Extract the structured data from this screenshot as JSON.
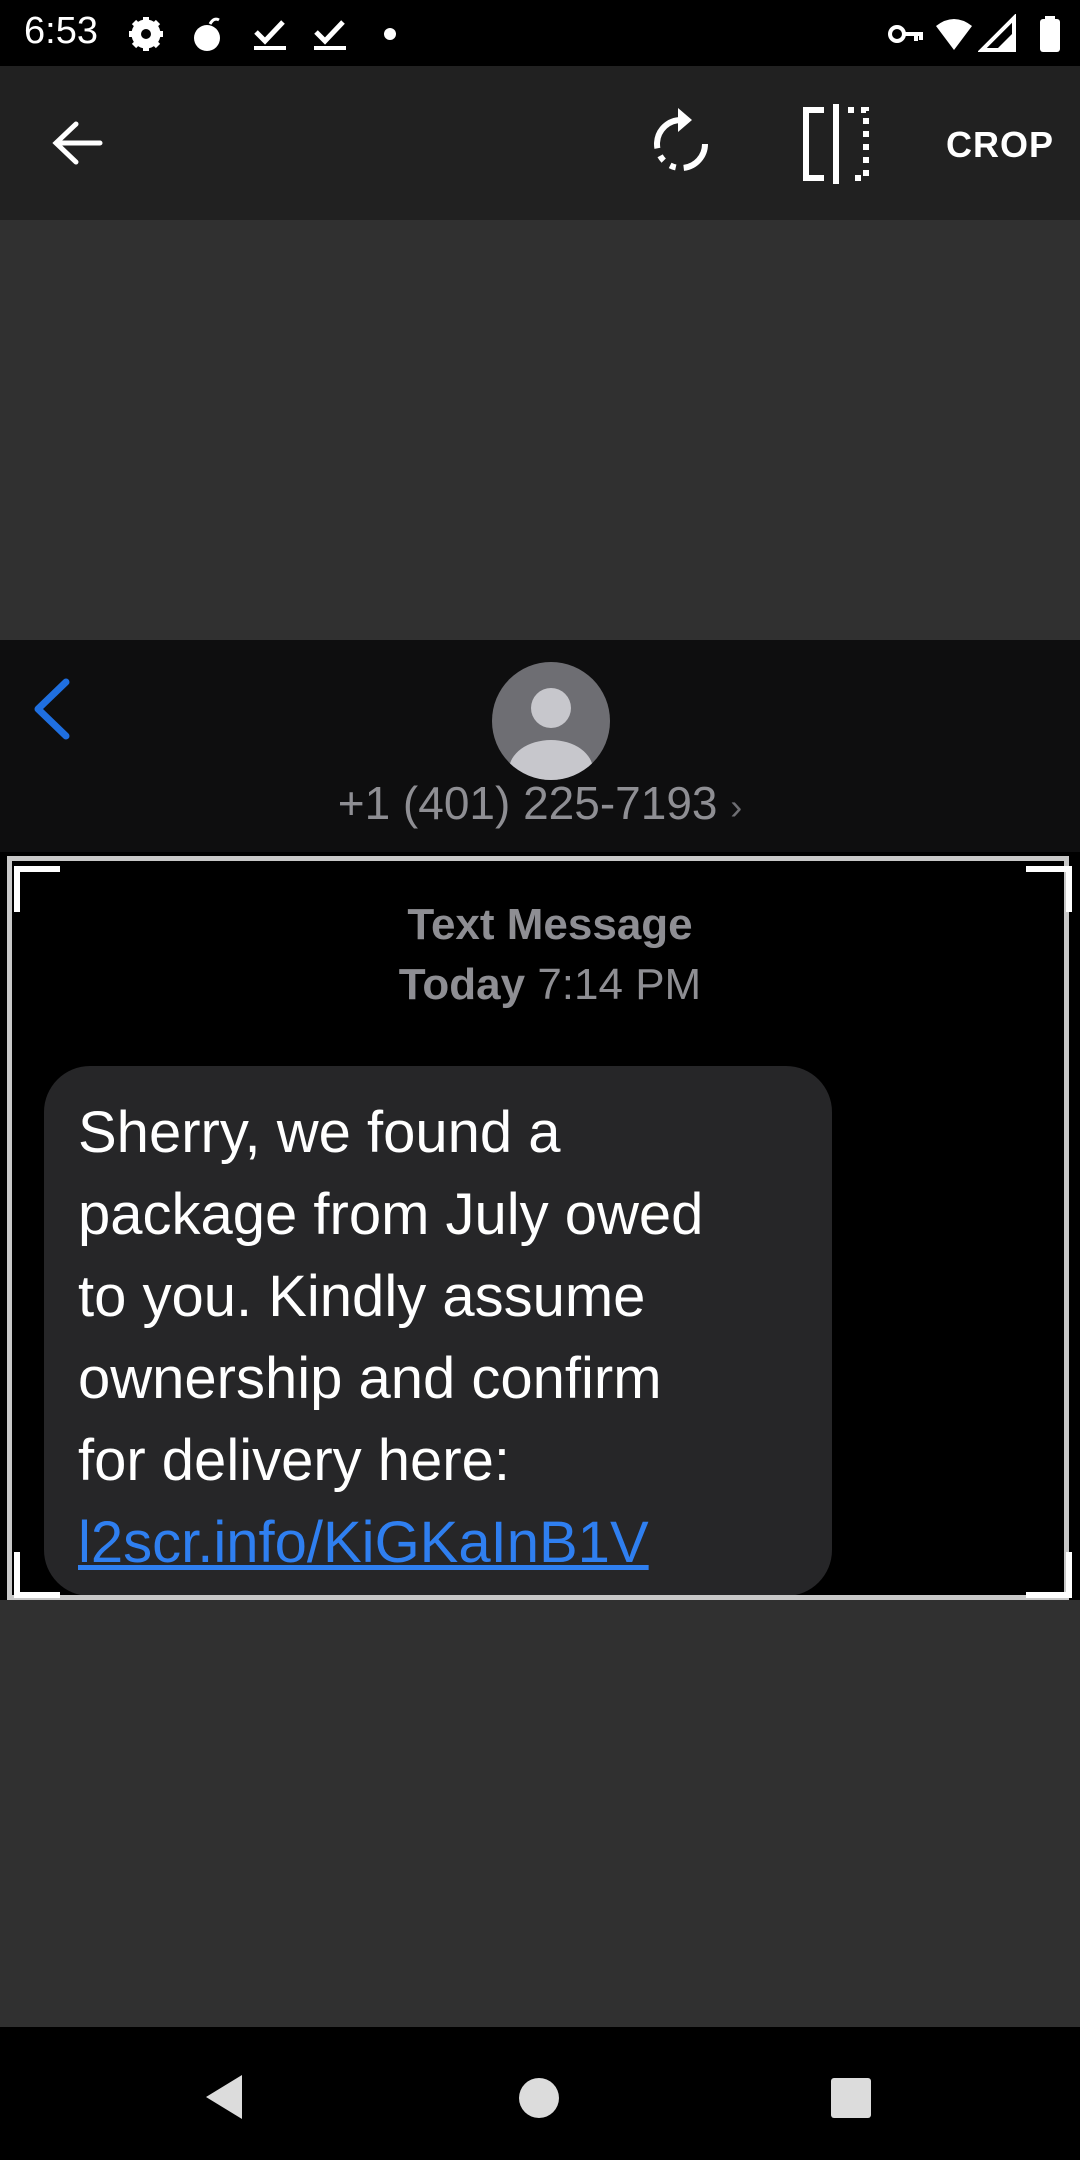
{
  "status_bar": {
    "time": "6:53",
    "left_icons": [
      "settings-icon",
      "bomb-icon",
      "check-download-icon",
      "check-download-icon",
      "dot-icon"
    ],
    "right_icons": [
      "vpn-key-icon",
      "wifi-icon",
      "signal-icon",
      "battery-icon"
    ]
  },
  "toolbar": {
    "back_icon": "arrow-back-icon",
    "rotate_icon": "rotate-icon",
    "flip_icon": "flip-icon",
    "crop_label": "CROP"
  },
  "screenshot": {
    "back_icon": "chevron-left-icon",
    "contact_number": "+1 (401) 225-7193",
    "contact_chevron": "›",
    "meta_title": "Text Message",
    "meta_day": "Today",
    "meta_time": "7:14 PM",
    "message_text": "Sherry, we found a\npackage from July owed\nto you. Kindly assume\nownership and confirm\nfor delivery here:",
    "message_link": "l2scr.info/KiGKaInB1V"
  },
  "colors": {
    "toolbar_bg": "#212121",
    "canvas_bg": "#303030",
    "bubble_bg": "#262628",
    "link": "#2f7ff0",
    "ios_blue": "#1f6fe0"
  }
}
